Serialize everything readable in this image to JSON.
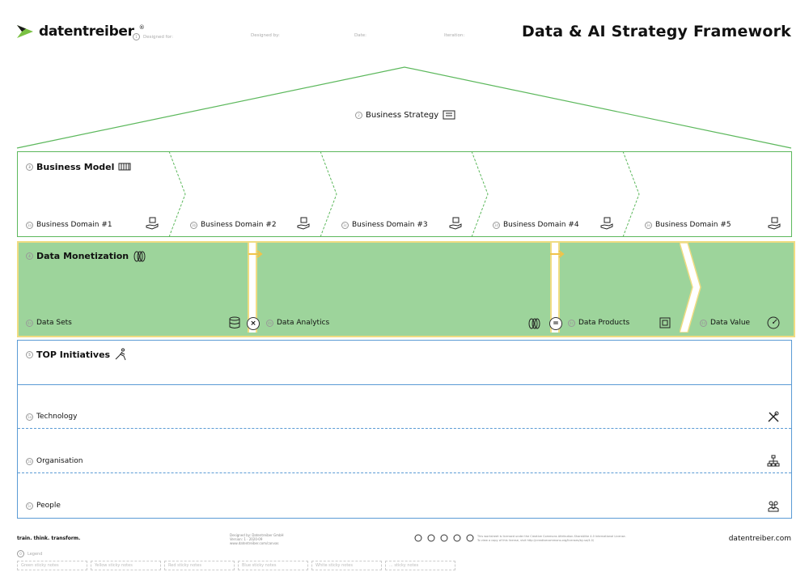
{
  "header": {
    "brand": "datentreiber",
    "brand_mark": "®",
    "fields": [
      "Designed for:",
      "Designed by:",
      "Date:",
      "Iteration:"
    ],
    "title": "Data & AI Strategy Framework"
  },
  "strategy": {
    "num": "2",
    "label": "Business Strategy"
  },
  "business_model": {
    "num": "3",
    "label": "Business Model",
    "domains": [
      {
        "num": "3a",
        "label": "Business Domain #1"
      },
      {
        "num": "3b",
        "label": "Business Domain #2"
      },
      {
        "num": "3c",
        "label": "Business Domain #3"
      },
      {
        "num": "3d",
        "label": "Business Domain #4"
      },
      {
        "num": "3e",
        "label": "Business Domain #5"
      }
    ]
  },
  "monetization": {
    "num": "4",
    "label": "Data Monetization",
    "steps": [
      {
        "num": "4a",
        "label": "Data Sets"
      },
      {
        "num": "4b",
        "label": "Data Analytics"
      },
      {
        "num": "4c",
        "label": "Data Products"
      },
      {
        "num": "4d",
        "label": "Data Value"
      }
    ],
    "op_multiply": "×",
    "op_equals": "="
  },
  "initiatives": {
    "num": "5",
    "label": "TOP Initiatives",
    "rows": [
      {
        "num": "5a",
        "label": "Technology"
      },
      {
        "num": "5b",
        "label": "Organisation"
      },
      {
        "num": "5c",
        "label": "People"
      }
    ]
  },
  "footer": {
    "slogan": "train. think. transform.",
    "credits": [
      "Designed by: Datentreiber GmbH",
      "Version: 1 · 2020-09",
      "www.datentreiber.com/canvas"
    ],
    "license": [
      "This worksheet is licensed under the Creative Commons Attribution-ShareAlike 4.0 International License.",
      "To view a copy of this license, visit http://creativecommons.org/licenses/by-sa/4.0/"
    ],
    "url": "datentreiber.com",
    "legend_num": "0",
    "legend_label": "Legend",
    "stickies": [
      "Green sticky notes",
      "Yellow sticky notes",
      "Red sticky notes",
      "Blue sticky notes",
      "White sticky notes",
      "... sticky notes"
    ]
  },
  "colors": {
    "green": "#5cb85c",
    "fill": "#9dd49b",
    "yellow": "#f0dc82",
    "blue": "#5b9bd5"
  }
}
